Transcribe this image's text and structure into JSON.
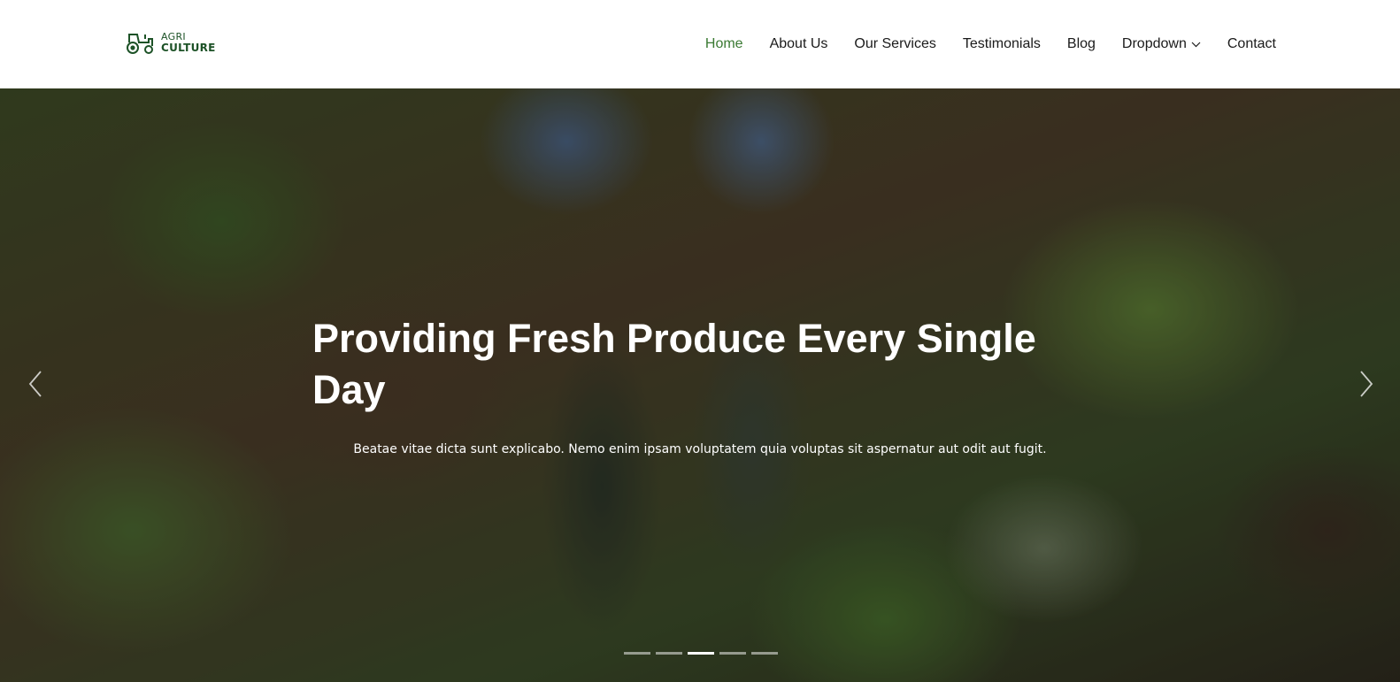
{
  "brand": {
    "line1": "AGRI",
    "line2": "CULTURE",
    "icon": "tractor-icon",
    "color": "#1d5227"
  },
  "nav": {
    "items": [
      {
        "label": "Home",
        "active": true
      },
      {
        "label": "About Us"
      },
      {
        "label": "Our Services"
      },
      {
        "label": "Testimonials"
      },
      {
        "label": "Blog"
      },
      {
        "label": "Dropdown",
        "has_dropdown": true
      },
      {
        "label": "Contact"
      }
    ],
    "active_color": "#3b7a33"
  },
  "hero": {
    "title": "Providing Fresh Produce Every Single Day",
    "text": "Beatae vitae dicta sunt explicabo. Nemo enim ipsam voluptatem quia voluptas sit aspernatur aut odit aut fugit.",
    "prev_icon": "chevron-left-icon",
    "next_icon": "chevron-right-icon",
    "slides_count": 5,
    "active_slide": 3
  }
}
